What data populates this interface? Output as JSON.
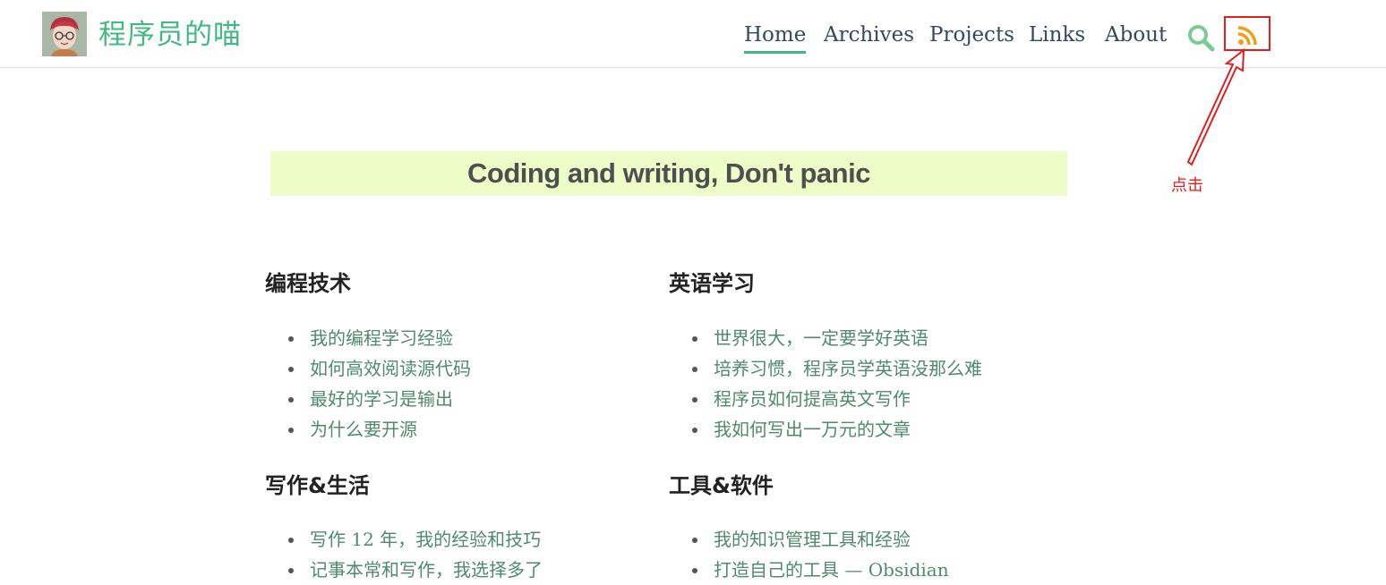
{
  "header": {
    "site_title": "程序员的喵",
    "nav": [
      {
        "label": "Home",
        "active": true
      },
      {
        "label": "Archives",
        "active": false
      },
      {
        "label": "Projects",
        "active": false
      },
      {
        "label": "Links",
        "active": false
      },
      {
        "label": "About",
        "active": false
      }
    ],
    "search_icon": "search-icon",
    "rss_icon": "rss-icon"
  },
  "annotation": {
    "text": "点击",
    "color": "#e11f1f"
  },
  "banner": {
    "text": "Coding and writing, Don't panic"
  },
  "sections": [
    {
      "title": "编程技术",
      "items": [
        "我的编程学习经验",
        "如何高效阅读源代码",
        "最好的学习是输出",
        "为什么要开源"
      ]
    },
    {
      "title": "英语学习",
      "items": [
        "世界很大，一定要学好英语",
        "培养习惯，程序员学英语没那么难",
        "程序员如何提高英文写作",
        "我如何写出一万元的文章"
      ]
    },
    {
      "title": "写作&生活",
      "items": [
        "写作 12 年，我的经验和技巧",
        "记事本常和写作，我选择多了"
      ]
    },
    {
      "title": "工具&软件",
      "items": [
        "我的知识管理工具和经验",
        "打造自己的工具 — Obsidian"
      ]
    }
  ],
  "colors": {
    "accent": "#42b983",
    "rss": "#f29d12",
    "banner_bg": "#eefcc8"
  }
}
